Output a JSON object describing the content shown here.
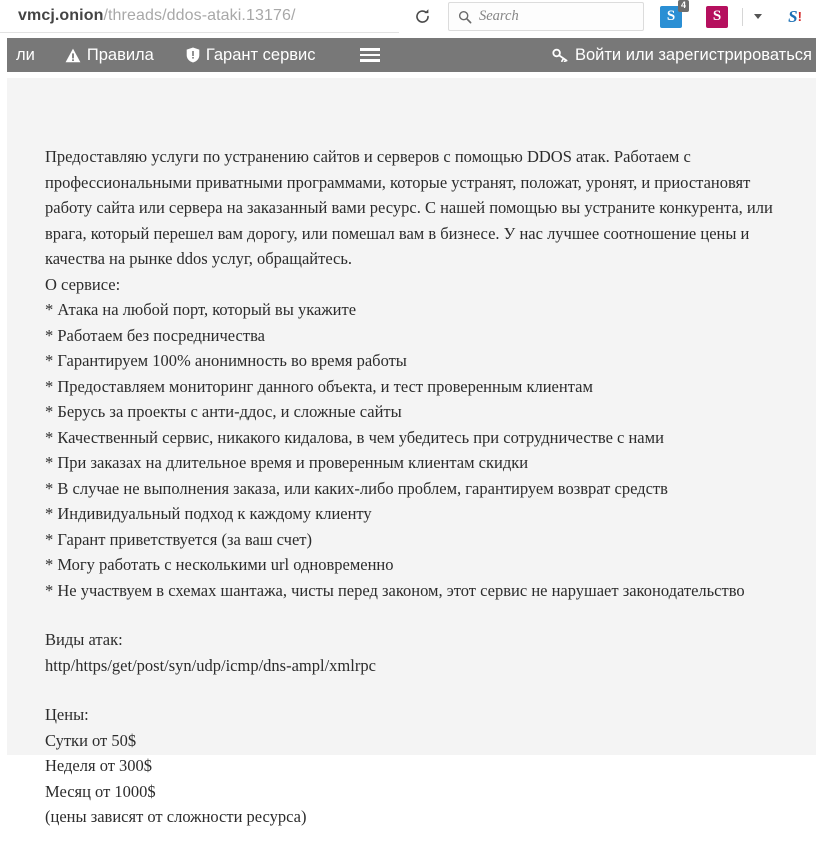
{
  "browser": {
    "url_host": "vmcj.onion",
    "url_path": "/threads/ddos-ataki.13176/",
    "reload_icon": "reload-icon",
    "search_placeholder": "Search",
    "search_icon": "search-icon",
    "extensions": [
      {
        "name": "skype-extension-icon",
        "glyph": "S",
        "badge": "4",
        "color": "#2a8fd4"
      },
      {
        "name": "s-extension-icon",
        "glyph": "S",
        "badge": "",
        "color": "#b5105e"
      },
      {
        "name": "s-alert-extension-icon",
        "glyph": "S",
        "badge": "",
        "color": "#1a6fb5"
      }
    ]
  },
  "site_nav": {
    "truncated_item": "ли",
    "rules_label": "Правила",
    "rules_icon": "warning-triangle-icon",
    "garant_label": "Гарант сервис",
    "garant_icon": "shield-icon",
    "menu_icon": "hamburger-menu-icon",
    "login_label": "Войти или зарегистрироваться",
    "login_icon": "key-icon"
  },
  "post": {
    "intro": "Предоставляю услуги по устранению сайтов и серверов с помощью DDOS атак. Работаем с профессиональными приватными программами, которые устранят, положат, уронят, и приостановят работу сайта или сервера на заказанный вами ресурс. С нашей помощью вы устраните конкурента, или врага, который перешел вам дорогу, или помешал вам в бизнесе. У нас лучшее соотношение цены и качества на рынке ddos услуг, обращайтесь.",
    "about_heading": "О сервисе:",
    "about_items": [
      "* Атака на любой порт, который вы укажите",
      "* Работаем без посредничества",
      "* Гарантируем 100% анонимность во время работы",
      "* Предоставляем мониторинг данного объекта, и тест проверенным клиентам",
      "* Берусь за проекты с анти-ддос, и сложные сайты",
      "* Качественный сервис, никакого кидалова, в чем убедитесь при сотрудничестве с нами",
      "* При заказах на длительное время и проверенным клиентам скидки",
      "* В случае не выполнения заказа, или каких-либо проблем, гарантируем возврат средств",
      "* Индивидуальный подход к каждому клиенту",
      "* Гарант приветствуется (за ваш счет)",
      "* Могу работать с несколькими url одновременно",
      "* Не участвуем в схемах шантажа, чисты перед законом, этот сервис не нарушает законодательство"
    ],
    "attack_types_heading": "Виды атак:",
    "attack_types_value": "http/https/get/post/syn/udp/icmp/dns-ampl/xmlrpc",
    "prices_heading": "Цены:",
    "prices": [
      "Сутки от 50$",
      "Неделя от 300$",
      "Месяц от 1000$",
      "(цены зависят от сложности ресурса)"
    ]
  }
}
